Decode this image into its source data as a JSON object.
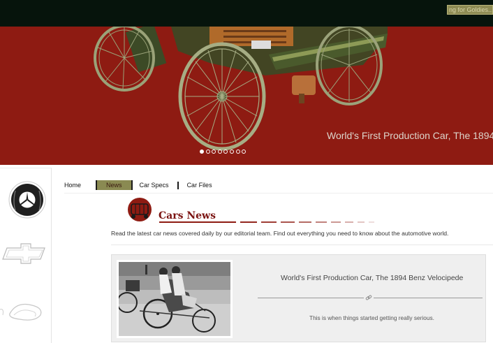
{
  "header": {
    "search_placeholder": "ng for Goldies..."
  },
  "hero": {
    "caption": "World's First Production Car, The 1894",
    "slide_count": 8,
    "active_slide": 1
  },
  "brands": {
    "mercedes_text": "MERCEDES BENZ",
    "chevrolet_text": "CHEVROLET"
  },
  "nav": {
    "home": "Home",
    "news": "News",
    "specs": "Car Specs",
    "files": "Car Files"
  },
  "section": {
    "title": "Cars News",
    "intro": "Read the latest car news covered daily by our editorial team. Find out everything you need to know about the automotive world."
  },
  "article": {
    "title": "World's First Production Car, The 1894 Benz Velocipede",
    "description": "This is when things started getting really serious."
  },
  "colors": {
    "topbar": "#06140c",
    "hero_bg": "#8e1b12",
    "nav_active": "#8a8a52",
    "heading": "#7a1210"
  }
}
